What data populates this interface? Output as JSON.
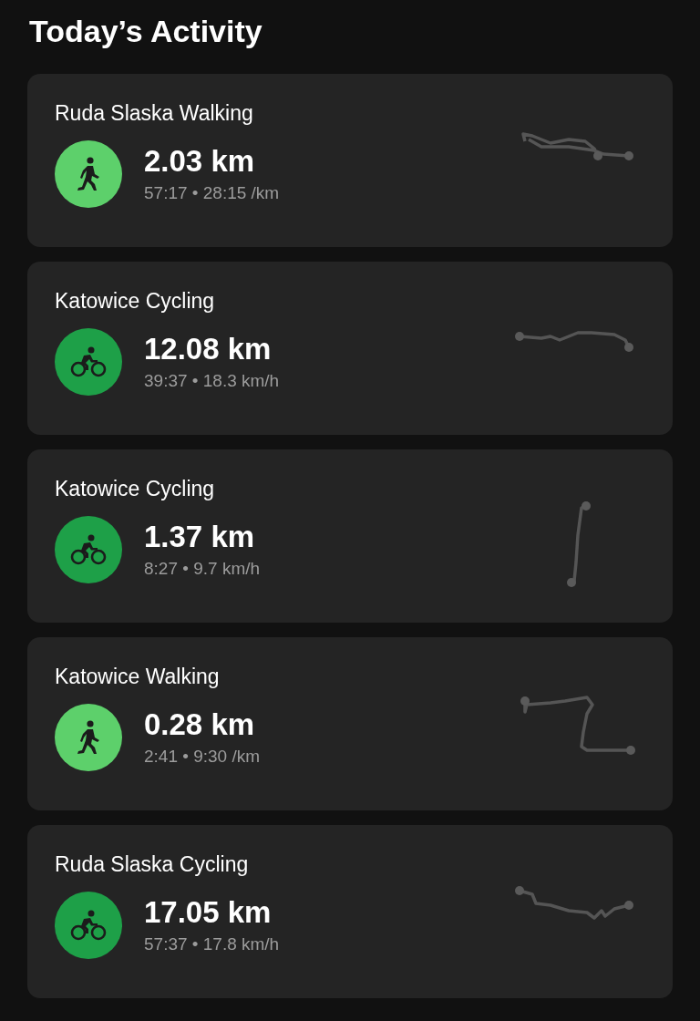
{
  "title": "Today’s Activity",
  "activities": [
    {
      "name": "Ruda Slaska Walking",
      "kind": "walking",
      "distance": "2.03 km",
      "stats": "57:17 • 28:15 /km"
    },
    {
      "name": "Katowice Cycling",
      "kind": "cycling",
      "distance": "12.08 km",
      "stats": "39:37 • 18.3 km/h"
    },
    {
      "name": "Katowice Cycling",
      "kind": "cycling",
      "distance": "1.37 km",
      "stats": "8:27 • 9.7 km/h"
    },
    {
      "name": "Katowice Walking",
      "kind": "walking",
      "distance": "0.28 km",
      "stats": "2:41 • 9:30 /km"
    },
    {
      "name": "Ruda Slaska Cycling",
      "kind": "cycling",
      "distance": "17.05 km",
      "stats": "57:37 • 17.8 km/h"
    }
  ]
}
